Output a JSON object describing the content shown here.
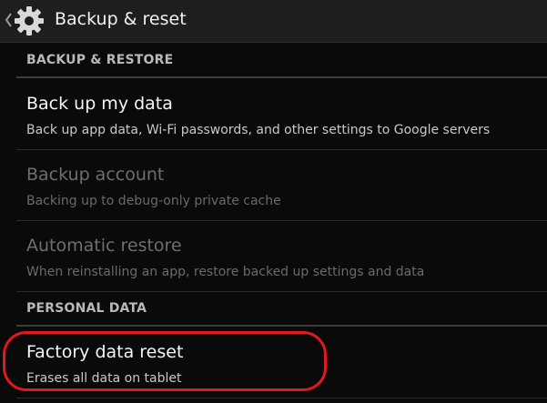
{
  "header": {
    "title": "Backup & reset",
    "up_icon": "chevron-left-icon",
    "app_icon": "gear-icon"
  },
  "sections": [
    {
      "label": "BACKUP & RESTORE",
      "items": [
        {
          "title": "Back up my data",
          "summary": "Back up app data, Wi-Fi passwords, and other settings to Google servers",
          "enabled": true
        },
        {
          "title": "Backup account",
          "summary": "Backing up to debug-only private cache",
          "enabled": false
        },
        {
          "title": "Automatic restore",
          "summary": "When reinstalling an app, restore backed up settings and data",
          "enabled": false
        }
      ]
    },
    {
      "label": "PERSONAL DATA",
      "items": [
        {
          "title": "Factory data reset",
          "summary": "Erases all data on tablet",
          "enabled": true
        }
      ]
    }
  ],
  "colors": {
    "background": "#0a0a0a",
    "action_bar": "#1e1e1e",
    "highlight": "#e0191f",
    "disabled_text": "#6e6e6e"
  }
}
